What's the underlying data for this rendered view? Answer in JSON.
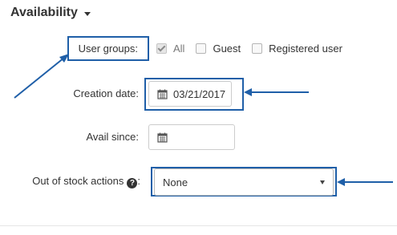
{
  "section": {
    "title": "Availability"
  },
  "user_groups": {
    "label": "User groups:",
    "options": [
      {
        "label": "All",
        "checked": true,
        "disabled": true
      },
      {
        "label": "Guest",
        "checked": false,
        "disabled": false
      },
      {
        "label": "Registered user",
        "checked": false,
        "disabled": false
      }
    ]
  },
  "creation_date": {
    "label": "Creation date:",
    "value": "03/21/2017"
  },
  "avail_since": {
    "label": "Avail since:",
    "value": ""
  },
  "out_of_stock": {
    "label": "Out of stock actions",
    "selected": "None"
  },
  "colors": {
    "highlight": "#1f5fa8"
  }
}
